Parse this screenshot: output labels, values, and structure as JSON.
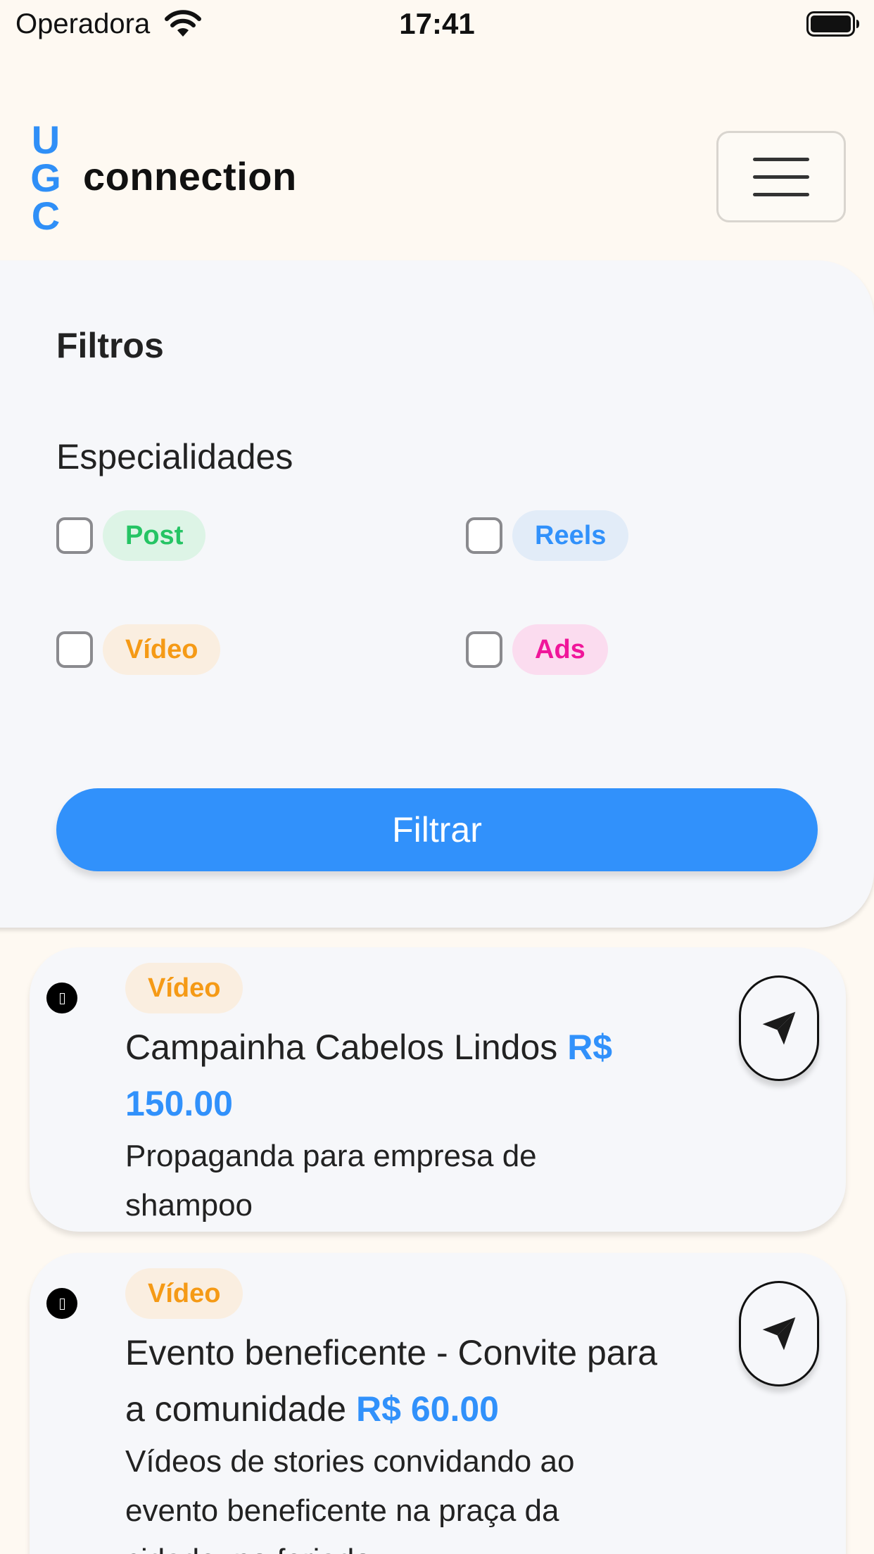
{
  "status_bar": {
    "carrier": "Operadora",
    "time": "17:41"
  },
  "header": {
    "logo_letters": [
      "U",
      "G",
      "C"
    ],
    "logo_word": "connection",
    "menu_icon": "hamburger-menu-icon"
  },
  "filters": {
    "title": "Filtros",
    "specialties_label": "Especialidades",
    "options": [
      {
        "label": "Post",
        "checked": false,
        "text_color": "#25c464",
        "bg_color": "#ddf4e6"
      },
      {
        "label": "Reels",
        "checked": false,
        "text_color": "#3191fb",
        "bg_color": "#e2ecf8"
      },
      {
        "label": "Vídeo",
        "checked": false,
        "text_color": "#f59a16",
        "bg_color": "#faeee0"
      },
      {
        "label": "Ads",
        "checked": false,
        "text_color": "#f0169a",
        "bg_color": "#fbdcef"
      }
    ],
    "submit_label": "Filtrar"
  },
  "campaigns": [
    {
      "tag": "Vídeo",
      "title": "Campainha Cabelos Lindos",
      "price": "R$ 150.00",
      "description": "Propaganda para empresa de shampoo",
      "action_icon": "send-icon"
    },
    {
      "tag": "Vídeo",
      "title": "Evento beneficente - Convite para a comunidade",
      "price": "R$ 60.00",
      "description": "Vídeos de stories convidando ao evento beneficente na praça da cidade, no feriado",
      "action_icon": "send-icon"
    }
  ],
  "colors": {
    "accent": "#3191fb",
    "background": "#fef9f2",
    "panel": "#f6f7fa"
  }
}
